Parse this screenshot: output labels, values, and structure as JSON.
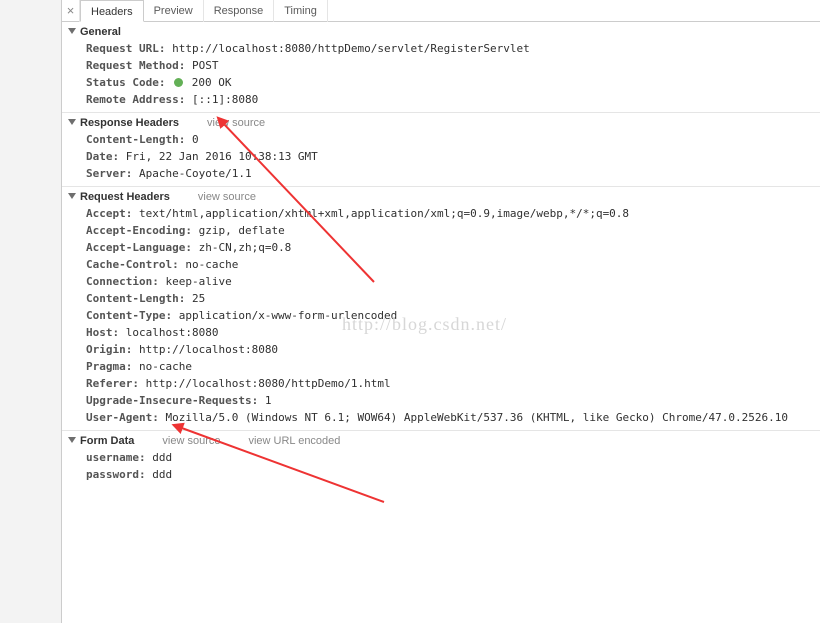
{
  "tabs": {
    "close": "×",
    "headers": "Headers",
    "preview": "Preview",
    "response": "Response",
    "timing": "Timing"
  },
  "general": {
    "title": "General",
    "request_url": {
      "k": "Request URL:",
      "v": "http://localhost:8080/httpDemo/servlet/RegisterServlet"
    },
    "request_method": {
      "k": "Request Method:",
      "v": "POST"
    },
    "status_code": {
      "k": "Status Code:",
      "v": "200 OK"
    },
    "remote_address": {
      "k": "Remote Address:",
      "v": "[::1]:8080"
    }
  },
  "response_headers": {
    "title": "Response Headers",
    "view_source": "view source",
    "content_length": {
      "k": "Content-Length:",
      "v": "0"
    },
    "date": {
      "k": "Date:",
      "v": "Fri, 22 Jan 2016 10:38:13 GMT"
    },
    "server": {
      "k": "Server:",
      "v": "Apache-Coyote/1.1"
    }
  },
  "request_headers": {
    "title": "Request Headers",
    "view_source": "view source",
    "accept": {
      "k": "Accept:",
      "v": "text/html,application/xhtml+xml,application/xml;q=0.9,image/webp,*/*;q=0.8"
    },
    "accept_encoding": {
      "k": "Accept-Encoding:",
      "v": "gzip, deflate"
    },
    "accept_language": {
      "k": "Accept-Language:",
      "v": "zh-CN,zh;q=0.8"
    },
    "cache_control": {
      "k": "Cache-Control:",
      "v": "no-cache"
    },
    "connection": {
      "k": "Connection:",
      "v": "keep-alive"
    },
    "content_length": {
      "k": "Content-Length:",
      "v": "25"
    },
    "content_type": {
      "k": "Content-Type:",
      "v": "application/x-www-form-urlencoded"
    },
    "host": {
      "k": "Host:",
      "v": "localhost:8080"
    },
    "origin": {
      "k": "Origin:",
      "v": "http://localhost:8080"
    },
    "pragma": {
      "k": "Pragma:",
      "v": "no-cache"
    },
    "referer": {
      "k": "Referer:",
      "v": "http://localhost:8080/httpDemo/1.html"
    },
    "upgrade_insecure": {
      "k": "Upgrade-Insecure-Requests:",
      "v": "1"
    },
    "user_agent": {
      "k": "User-Agent:",
      "v": "Mozilla/5.0 (Windows NT 6.1; WOW64) AppleWebKit/537.36 (KHTML, like Gecko) Chrome/47.0.2526.10"
    }
  },
  "form_data": {
    "title": "Form Data",
    "view_source": "view source",
    "view_url_encoded": "view URL encoded",
    "username": {
      "k": "username:",
      "v": "ddd"
    },
    "password": {
      "k": "password:",
      "v": "ddd"
    }
  },
  "watermark": "http://blog.csdn.net/"
}
